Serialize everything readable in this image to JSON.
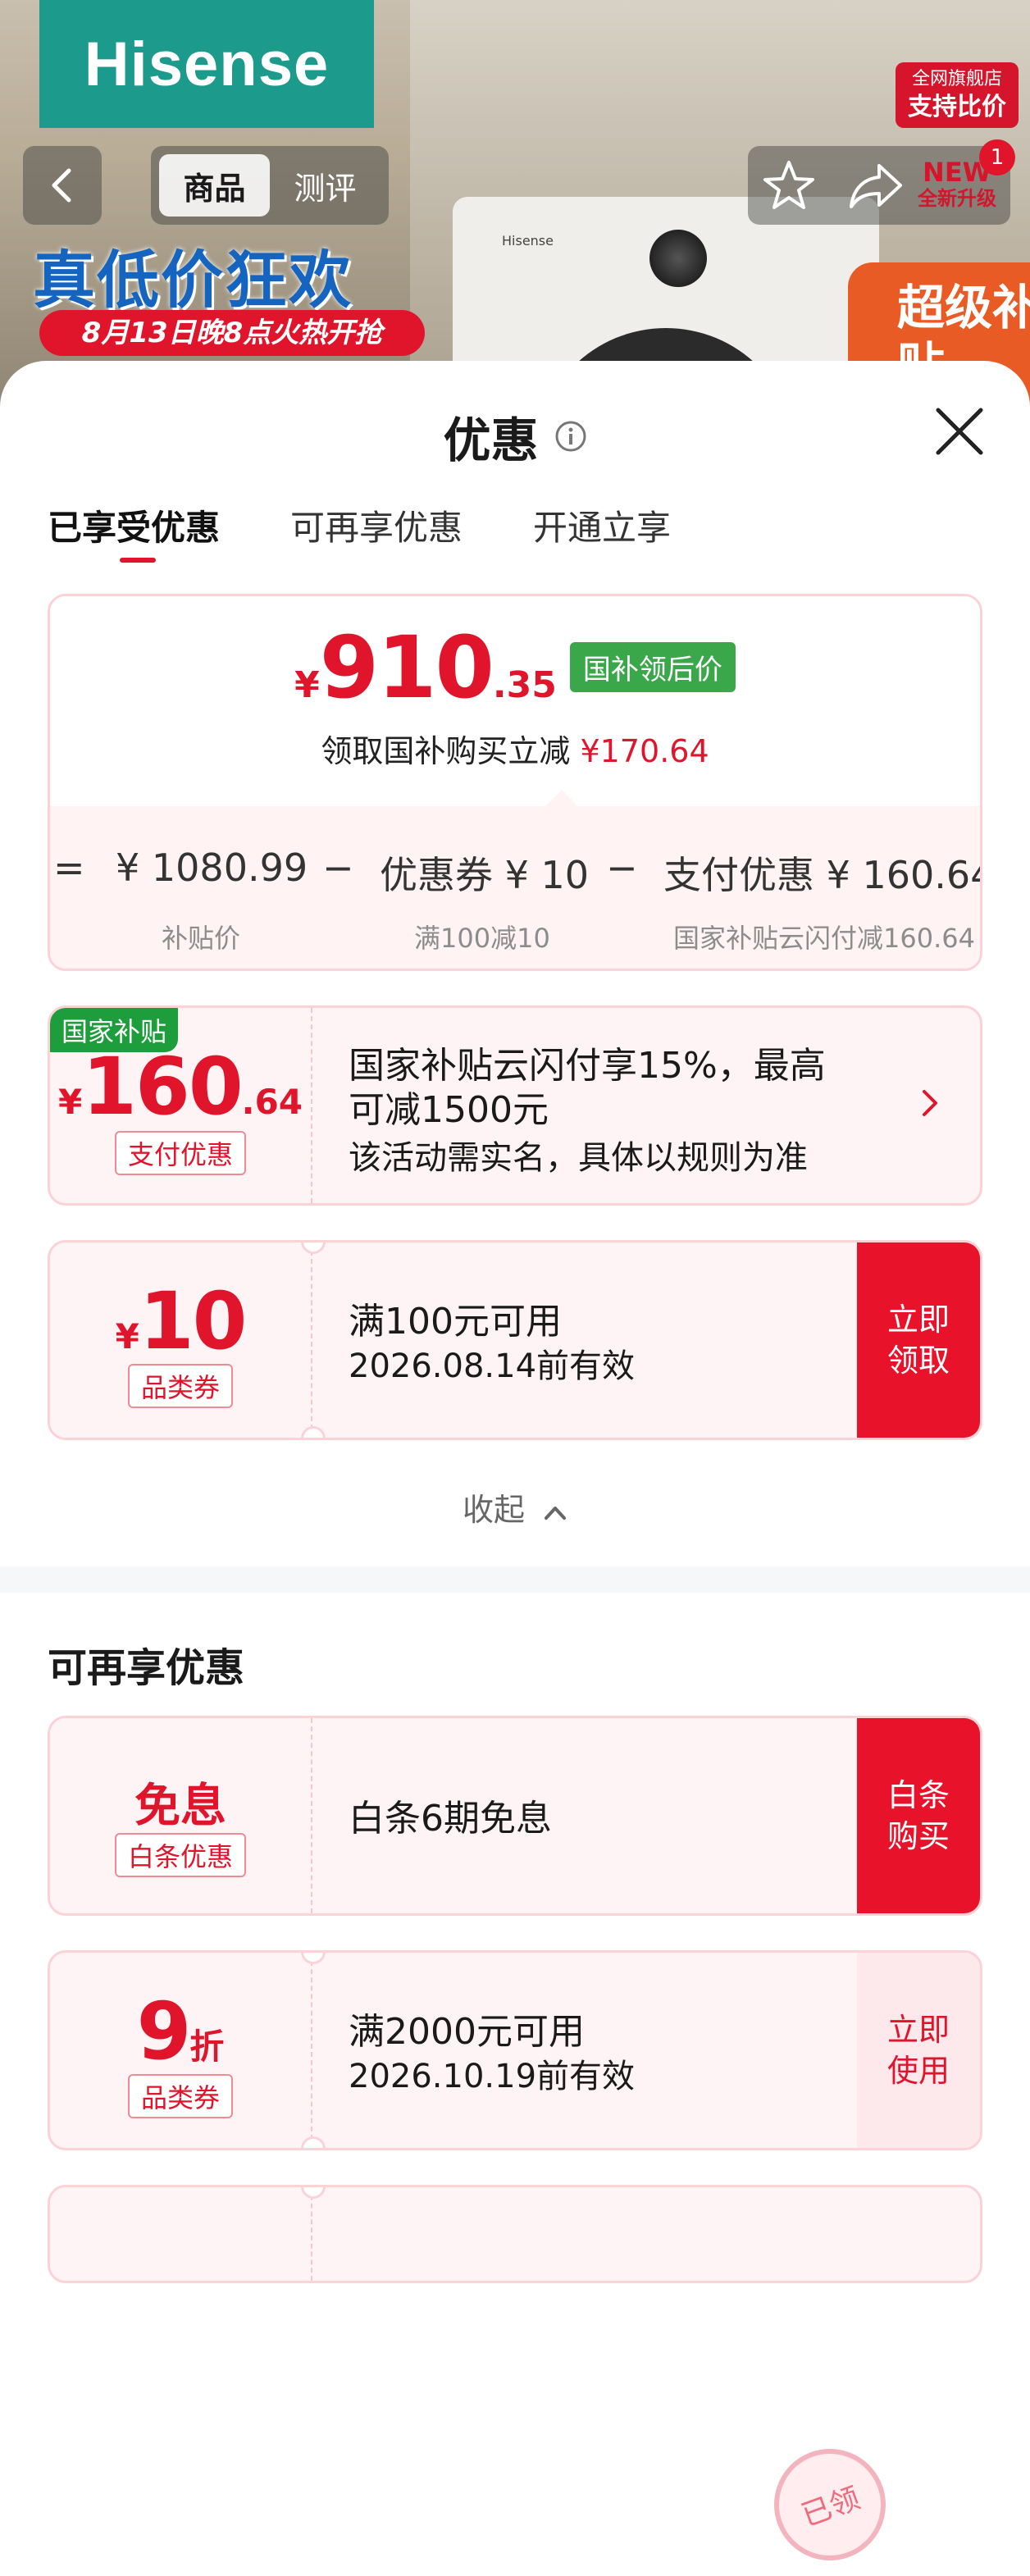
{
  "header": {
    "brand": "Hisense",
    "flagship_line1": "全网旗舰店",
    "flagship_line2": "支持比价",
    "promo_title": "真低价狂欢",
    "promo_date": "8月13日晚8点火热开抢",
    "super_badge": "超级补贴",
    "washer_logo": "Hisense",
    "segments": [
      "商品",
      "测评"
    ],
    "new_tag_line1": "NEW",
    "new_tag_line2": "全新升级",
    "cart_count": "1"
  },
  "sheet": {
    "title": "优惠",
    "tabs": [
      "已享受优惠",
      "可再享优惠",
      "开通立享"
    ]
  },
  "summary": {
    "currency": "¥",
    "price_int": "910",
    "price_dec": ".35",
    "price_tag": "国补领后价",
    "subnote_prefix": "领取国补购买立减",
    "subnote_amount": "¥170.64",
    "calc": {
      "eq": "=",
      "base_value": "¥ 1080.99",
      "base_label": "补贴价",
      "minus1": "−",
      "coupon_value": "优惠券 ¥ 10",
      "coupon_label": "满100减10",
      "minus2": "−",
      "pay_value": "支付优惠 ¥ 160.64",
      "pay_label": "国家补贴云闪付减160.64"
    }
  },
  "coupons_enjoyed": [
    {
      "badge": "国家补贴",
      "yen": "¥",
      "amount": "160",
      "decimal": ".64",
      "type": "支付优惠",
      "line1": "国家补贴云闪付享15%，最高",
      "line1b": "可减1500元",
      "line2": "该活动需实名，具体以规则为准"
    },
    {
      "yen": "¥",
      "amount": "10",
      "type": "品类券",
      "line1": "满100元可用",
      "line2": "2026.08.14前有效",
      "action": "立即领取"
    }
  ],
  "collapse_label": "收起",
  "more_section": {
    "title": "可再享优惠",
    "items": [
      {
        "amount": "免息",
        "type": "白条优惠",
        "line1": "白条6期免息",
        "action": "白条购买"
      },
      {
        "amount": "9",
        "unit": "折",
        "type": "品类券",
        "line1": "满2000元可用",
        "line2": "2026.10.19前有效",
        "action": "立即使用",
        "stamp": "已领"
      }
    ]
  },
  "colors": {
    "accent_red": "#e0152b",
    "green_tag": "#3aa84a",
    "card_border": "#fbd2d6",
    "card_bg": "#fff4f5",
    "brand_teal": "#1c9a8c"
  }
}
